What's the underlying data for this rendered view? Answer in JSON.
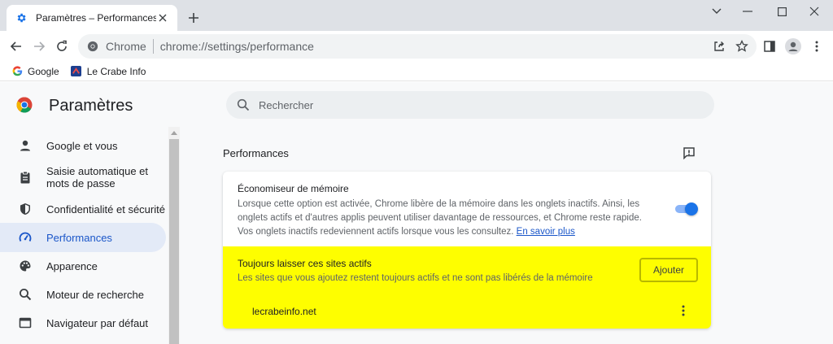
{
  "tab": {
    "title": "Paramètres – Performances"
  },
  "toolbar": {
    "site_chip": "Chrome",
    "url_prefix": "chrome://",
    "url_path": "settings/performance"
  },
  "bookmarks": [
    {
      "label": "Google"
    },
    {
      "label": "Le Crabe Info"
    }
  ],
  "settings": {
    "title": "Paramètres",
    "search_placeholder": "Rechercher"
  },
  "sidebar": {
    "items": [
      {
        "label": "Google et vous"
      },
      {
        "label": "Saisie automatique et mots de passe"
      },
      {
        "label": "Confidentialité et sécurité"
      },
      {
        "label": "Performances"
      },
      {
        "label": "Apparence"
      },
      {
        "label": "Moteur de recherche"
      },
      {
        "label": "Navigateur par défaut"
      }
    ]
  },
  "main": {
    "section_title": "Performances",
    "memory_saver": {
      "title": "Économiseur de mémoire",
      "description": "Lorsque cette option est activée, Chrome libère de la mémoire dans les onglets inactifs. Ainsi, les onglets actifs et d'autres applis peuvent utiliser davantage de ressources, et Chrome reste rapide. Vos onglets inactifs redeviennent actifs lorsque vous les consultez.",
      "learn_more": "En savoir plus",
      "enabled": true
    },
    "always_active": {
      "title": "Toujours laisser ces sites actifs",
      "description": "Les sites que vous ajoutez restent toujours actifs et ne sont pas libérés de la mémoire",
      "add_label": "Ajouter",
      "sites": [
        {
          "name": "lecrabeinfo.net"
        }
      ]
    }
  },
  "colors": {
    "accent": "#1a73e8",
    "highlight": "#fefe00",
    "active_nav_bg": "#e3eaf7"
  }
}
